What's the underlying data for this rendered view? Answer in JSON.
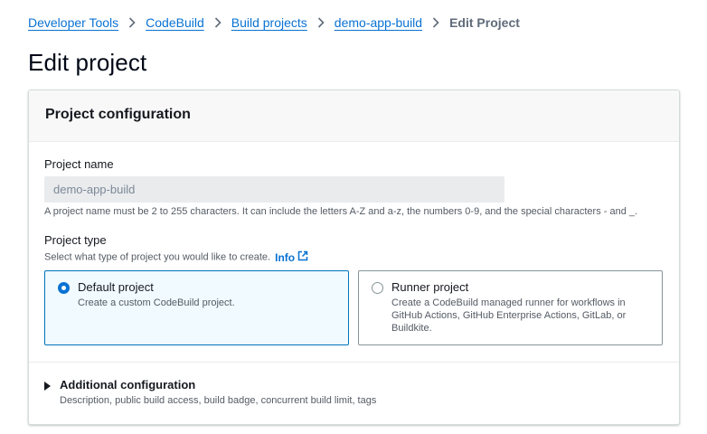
{
  "breadcrumb": {
    "items": [
      "Developer Tools",
      "CodeBuild",
      "Build projects",
      "demo-app-build"
    ],
    "current": "Edit Project"
  },
  "page": {
    "title": "Edit project"
  },
  "project_configuration": {
    "title": "Project configuration",
    "project_name": {
      "label": "Project name",
      "value": "demo-app-build",
      "hint": "A project name must be 2 to 255 characters. It can include the letters A-Z and a-z, the numbers 0-9, and the special characters - and _."
    },
    "project_type": {
      "label": "Project type",
      "description": "Select what type of project you would like to create.",
      "info_link": "Info",
      "options": [
        {
          "title": "Default project",
          "description": "Create a custom CodeBuild project.",
          "selected": true
        },
        {
          "title": "Runner project",
          "description": "Create a CodeBuild managed runner for workflows in GitHub Actions, GitHub Enterprise Actions, GitLab, or Buildkite.",
          "selected": false
        }
      ]
    },
    "additional_configuration": {
      "title": "Additional configuration",
      "description": "Description, public build access, build badge, concurrent build limit, tags"
    }
  },
  "colors": {
    "link": "#0972d3",
    "selected_border": "#0073bb",
    "selected_background": "#f1faff"
  },
  "icons": {
    "separator": "chevron-right-icon",
    "external": "external-link-icon",
    "expander": "caret-right-icon"
  }
}
